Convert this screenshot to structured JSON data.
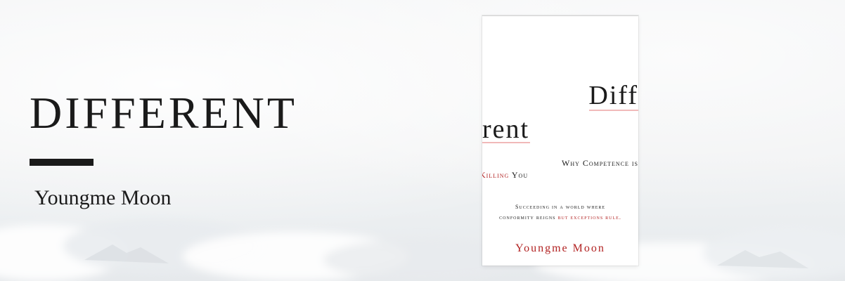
{
  "hero": {
    "title": "DIFFERENT",
    "author": "Youngme Moon"
  },
  "cover": {
    "title_top": "Diff",
    "title_bottom": "rent",
    "subtitle_line1": "Why Competence is",
    "subtitle_line2_red": "Killing",
    "subtitle_line2_rest": " You",
    "tagline_line1": "Succeeding in a world where",
    "tagline_line2_black": "conformity reigns ",
    "tagline_line2_red": "but exceptions rule.",
    "author": "Youngme Moon"
  },
  "colors": {
    "text": "#1a1a1a",
    "accent_red": "#b22222",
    "underline_pink": "#f1b9b9",
    "cover_bg": "#ffffff",
    "sky": "#f1f2f3"
  }
}
